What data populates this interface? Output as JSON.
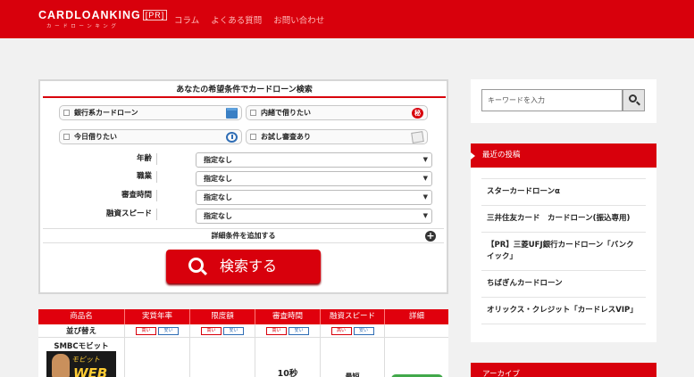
{
  "header": {
    "logo_text": "CARDLOANKING",
    "logo_pr": "[PR]",
    "logo_sub": "カードローンキング",
    "nav": [
      "コラム",
      "よくある質問",
      "お問い合わせ"
    ]
  },
  "search_panel": {
    "title": "あなたの希望条件でカードローン検索",
    "checkboxes": [
      {
        "label": "銀行系カードローン",
        "icon": "bank-icon"
      },
      {
        "label": "内緒で借りたい",
        "icon": "secret-icon",
        "icon_char": "秘"
      },
      {
        "label": "今日借りたい",
        "icon": "clock-icon"
      },
      {
        "label": "お試し審査あり",
        "icon": "document-icon"
      }
    ],
    "fields": [
      {
        "label": "年齢",
        "value": "指定なし"
      },
      {
        "label": "職業",
        "value": "指定なし"
      },
      {
        "label": "審査時間",
        "value": "指定なし"
      },
      {
        "label": "融資スピード",
        "value": "指定なし"
      }
    ],
    "detail_label": "詳細条件を追加する",
    "search_button": "検索する"
  },
  "table": {
    "headers": [
      "商品名",
      "実質年率",
      "限度額",
      "審査時間",
      "融資スピード",
      "詳細"
    ],
    "sort_label": "並び替え",
    "sort_buttons": [
      "高い",
      "安い"
    ],
    "rows": [
      {
        "name": "SMBCモビット",
        "img_text1": "モビット",
        "img_text2": "WEB",
        "rate": "",
        "limit": "",
        "review_time": "10秒",
        "speed": "最短",
        "detail": ""
      }
    ]
  },
  "sidebar": {
    "search_placeholder": "キーワードを入力",
    "recent_title": "最近の投稿",
    "recent_posts": [
      "スターカードローンα",
      "三井住友カード　カードローン(振込専用)",
      "【PR】三菱UFJ銀行カードローン「バンクイック」",
      "ちばぎんカードローン",
      "オリックス・クレジット「カードレスVIP」"
    ],
    "archive_title": "アーカイブ"
  },
  "colors": {
    "brand_red": "#d8000c",
    "table_red": "#e0000d",
    "green": "#41a84a"
  }
}
